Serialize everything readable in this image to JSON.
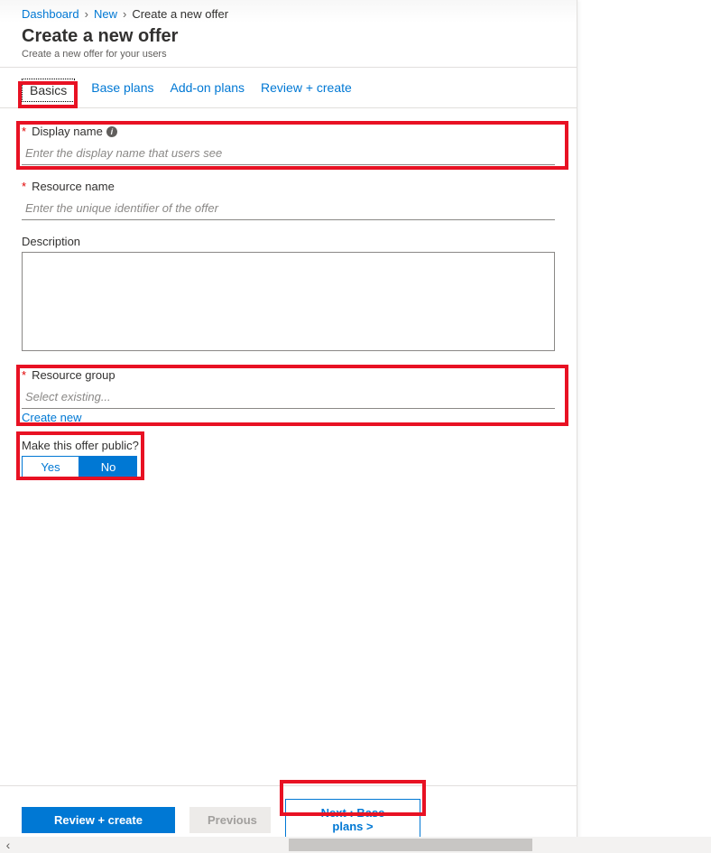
{
  "breadcrumb": {
    "items": [
      {
        "label": "Dashboard",
        "link": true
      },
      {
        "label": "New",
        "link": true
      },
      {
        "label": "Create a new offer",
        "link": false
      }
    ]
  },
  "title": "Create a new offer",
  "subtitle": "Create a new offer for your users",
  "tabs": [
    {
      "label": "Basics",
      "active": true
    },
    {
      "label": "Base plans",
      "active": false
    },
    {
      "label": "Add-on plans",
      "active": false
    },
    {
      "label": "Review + create",
      "active": false
    }
  ],
  "fields": {
    "displayName": {
      "label": "Display name",
      "placeholder": "Enter the display name that users see",
      "required": true,
      "info": true
    },
    "resourceName": {
      "label": "Resource name",
      "placeholder": "Enter the unique identifier of the offer",
      "required": true
    },
    "description": {
      "label": "Description"
    },
    "resourceGroup": {
      "label": "Resource group",
      "placeholder": "Select existing...",
      "required": true,
      "createNew": "Create new"
    },
    "public": {
      "label": "Make this offer public?",
      "yes": "Yes",
      "no": "No",
      "value": "No"
    }
  },
  "footer": {
    "review": "Review + create",
    "previous": "Previous",
    "next": "Next : Base plans >"
  }
}
